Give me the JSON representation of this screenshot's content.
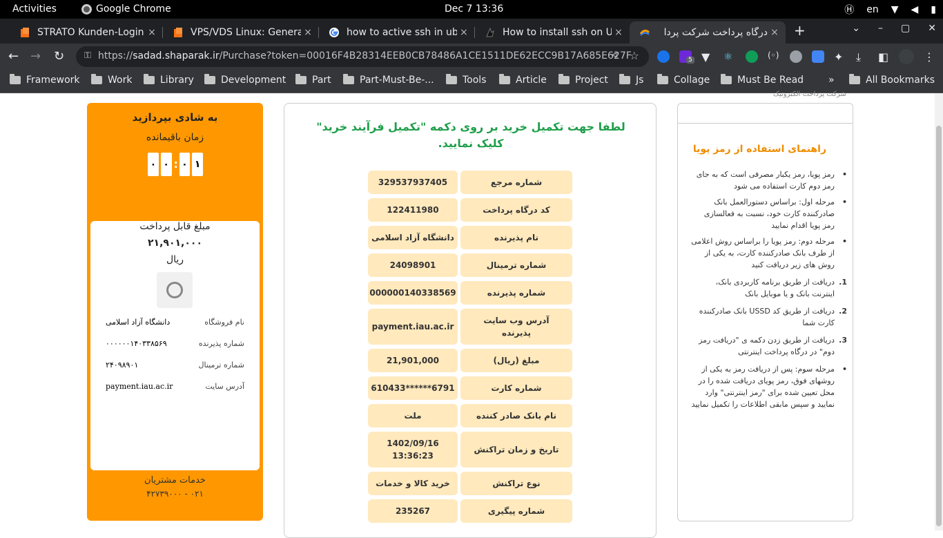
{
  "system": {
    "activities": "Activities",
    "app_name": "Google Chrome",
    "clock": "Dec 7  13:36",
    "lang": "en"
  },
  "tabs": [
    {
      "title": "STRATO Kunden-Login",
      "close": "×"
    },
    {
      "title": "VPS/VDS Linux: Genera",
      "close": "×"
    },
    {
      "title": "how to active ssh in ubu",
      "close": "×"
    },
    {
      "title": "How to install ssh on U",
      "close": "×"
    },
    {
      "title": "درگاه پرداخت شرکت پردا",
      "close": "×"
    }
  ],
  "toolbar": {
    "url_prefix": "https://",
    "url_host": "sadad.shaparak.ir",
    "url_path": "/Purchase?token=00016F4B28314EEB0CB78486A1CE1511DE62ECC9B17A685E627F",
    "ext_badge": "5"
  },
  "bookmarks": {
    "items": [
      "Framework",
      "Work",
      "Library",
      "Development",
      "Part",
      "Part-Must-Be-...",
      "Tools",
      "Article",
      "Project",
      "Js",
      "Collage",
      "Must Be Read"
    ],
    "more": "»",
    "all": "All Bookmarks"
  },
  "sidebar": {
    "title": "به شادی بپردازید",
    "remaining_label": "زمان باقیمانده",
    "timer": [
      "۰",
      "۰",
      "۰",
      "۱"
    ],
    "amount_label": "مبلغ قابل پرداخت",
    "amount_value": "۲۱,۹۰۱,۰۰۰",
    "currency": "ریال",
    "details": [
      {
        "key": "نام فروشگاه",
        "value": "دانشگاه آزاد اسلامی"
      },
      {
        "key": "شماره پذیرنده",
        "value": "۰۰۰۰۰۰۱۴۰۳۳۸۵۶۹"
      },
      {
        "key": "شماره ترمینال",
        "value": "۲۴۰۹۸۹۰۱"
      },
      {
        "key": "آدرس سایت",
        "value": "payment.iau.ac.ir"
      }
    ],
    "support_label": "خدمات مشتریان",
    "support_phone": "۰۲۱ - ۴۲۷۳۹۰۰۰"
  },
  "main": {
    "heading": "لطفا جهت تکمیل خرید بر روی دکمه \"تکمیل فرآیند خرید\" کلیک نمایید.",
    "rows": [
      {
        "key": "شماره مرجع",
        "value": "329537937405"
      },
      {
        "key": "کد درگاه پرداخت",
        "value": "122411980"
      },
      {
        "key": "نام پذیرنده",
        "value": "دانشگاه آزاد اسلامی"
      },
      {
        "key": "شماره ترمینال",
        "value": "24098901"
      },
      {
        "key": "شماره پذیرنده",
        "value": "000000140338569"
      },
      {
        "key": "آدرس وب سایت پذیرنده",
        "value": "payment.iau.ac.ir"
      },
      {
        "key": "مبلغ (ریال)",
        "value": "21,901,000"
      },
      {
        "key": "شماره کارت",
        "value": "610433******6791"
      },
      {
        "key": "نام بانک صادر کننده",
        "value": "ملت"
      },
      {
        "key": "تاریخ و زمان تراکنش",
        "value": "1402/09/16 13:36:23"
      },
      {
        "key": "نوع تراکنش",
        "value": "خرید کالا و خدمات"
      },
      {
        "key": "شماره پیگیری",
        "value": "235267"
      }
    ]
  },
  "help": {
    "top_text": "شرکت پرداخت الکترونیک",
    "title": "راهنمای استفاده از رمز پویا",
    "items": [
      {
        "bullet": "•",
        "text": "رمز پویا، رمز یکبار مصرفی است که به جای رمز دوم کارت استفاده می شود"
      },
      {
        "bullet": "•",
        "text": "مرحله اول: براساس دستورالعمل بانک صادرکننده کارت خود، نسبت به فعالسازی رمز پویا اقدام نمایید"
      },
      {
        "bullet": "•",
        "text": "مرحله دوم: رمز پویا را براساس روش اعلامی از طرف بانک صادرکننده کارت، به یکی از روش های زیر دریافت کنید"
      },
      {
        "bullet": "1.",
        "text": "دریافت از طریق برنامه کاربردی بانک، اینترنت بانک و یا موبایل بانک"
      },
      {
        "bullet": "2.",
        "text": "دریافت از طریق کد USSD بانک صادرکننده کارت شما"
      },
      {
        "bullet": "3.",
        "text": "دریافت از طریق زدن دکمه ی \"دریافت رمز دوم\" در درگاه پرداخت اینترنتی"
      },
      {
        "bullet": "•",
        "text": "مرحله سوم: پس از دریافت رمز به یکی از روشهای فوق، رمز پویای دریافت شده را در محل تعیین شده برای \"رمز اینترنتی\" وارد نمایید و سپس مابقی اطلاعات را تکمیل نمایید"
      }
    ]
  },
  "colors": {
    "accent": "#ff9800",
    "heading_green": "#1e9e4a",
    "row_bg": "#ffe9bd",
    "help_title": "#f08c00"
  }
}
